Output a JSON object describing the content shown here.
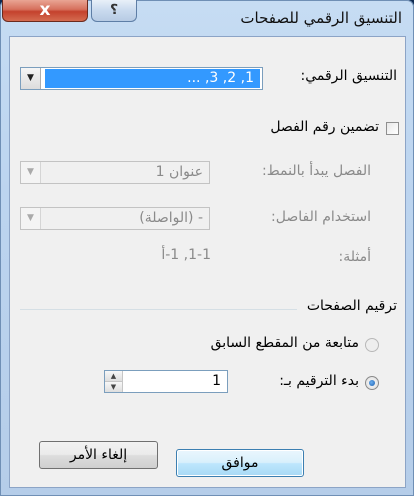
{
  "window": {
    "title": "التنسيق الرقمي للصفحات",
    "close_glyph": "x",
    "help_glyph": "؟"
  },
  "number_format": {
    "label": "التنسيق الرقمي:",
    "value": "1, 2, 3, ..."
  },
  "include_chapter": {
    "label": "تضمين رقم الفصل",
    "checked": false
  },
  "chapter_style": {
    "label": "الفصل يبدأ بالنمط:",
    "value": "عنوان 1"
  },
  "separator": {
    "label": "استخدام الفاصل:",
    "value": "-   (الواصلة)"
  },
  "examples": {
    "label": "أمثلة:",
    "value": "1-1, 1-أ"
  },
  "page_numbering": {
    "group_label": "ترقيم الصفحات",
    "continue_label": "متابعة من المقطع السابق",
    "start_at_label": "بدء الترقيم بـ:",
    "start_at_value": "1",
    "selected": "start_at"
  },
  "buttons": {
    "ok": "موافق",
    "cancel": "إلغاء الأمر"
  },
  "colors": {
    "selection": "#3399ff",
    "frame": "#bcd4ef"
  }
}
